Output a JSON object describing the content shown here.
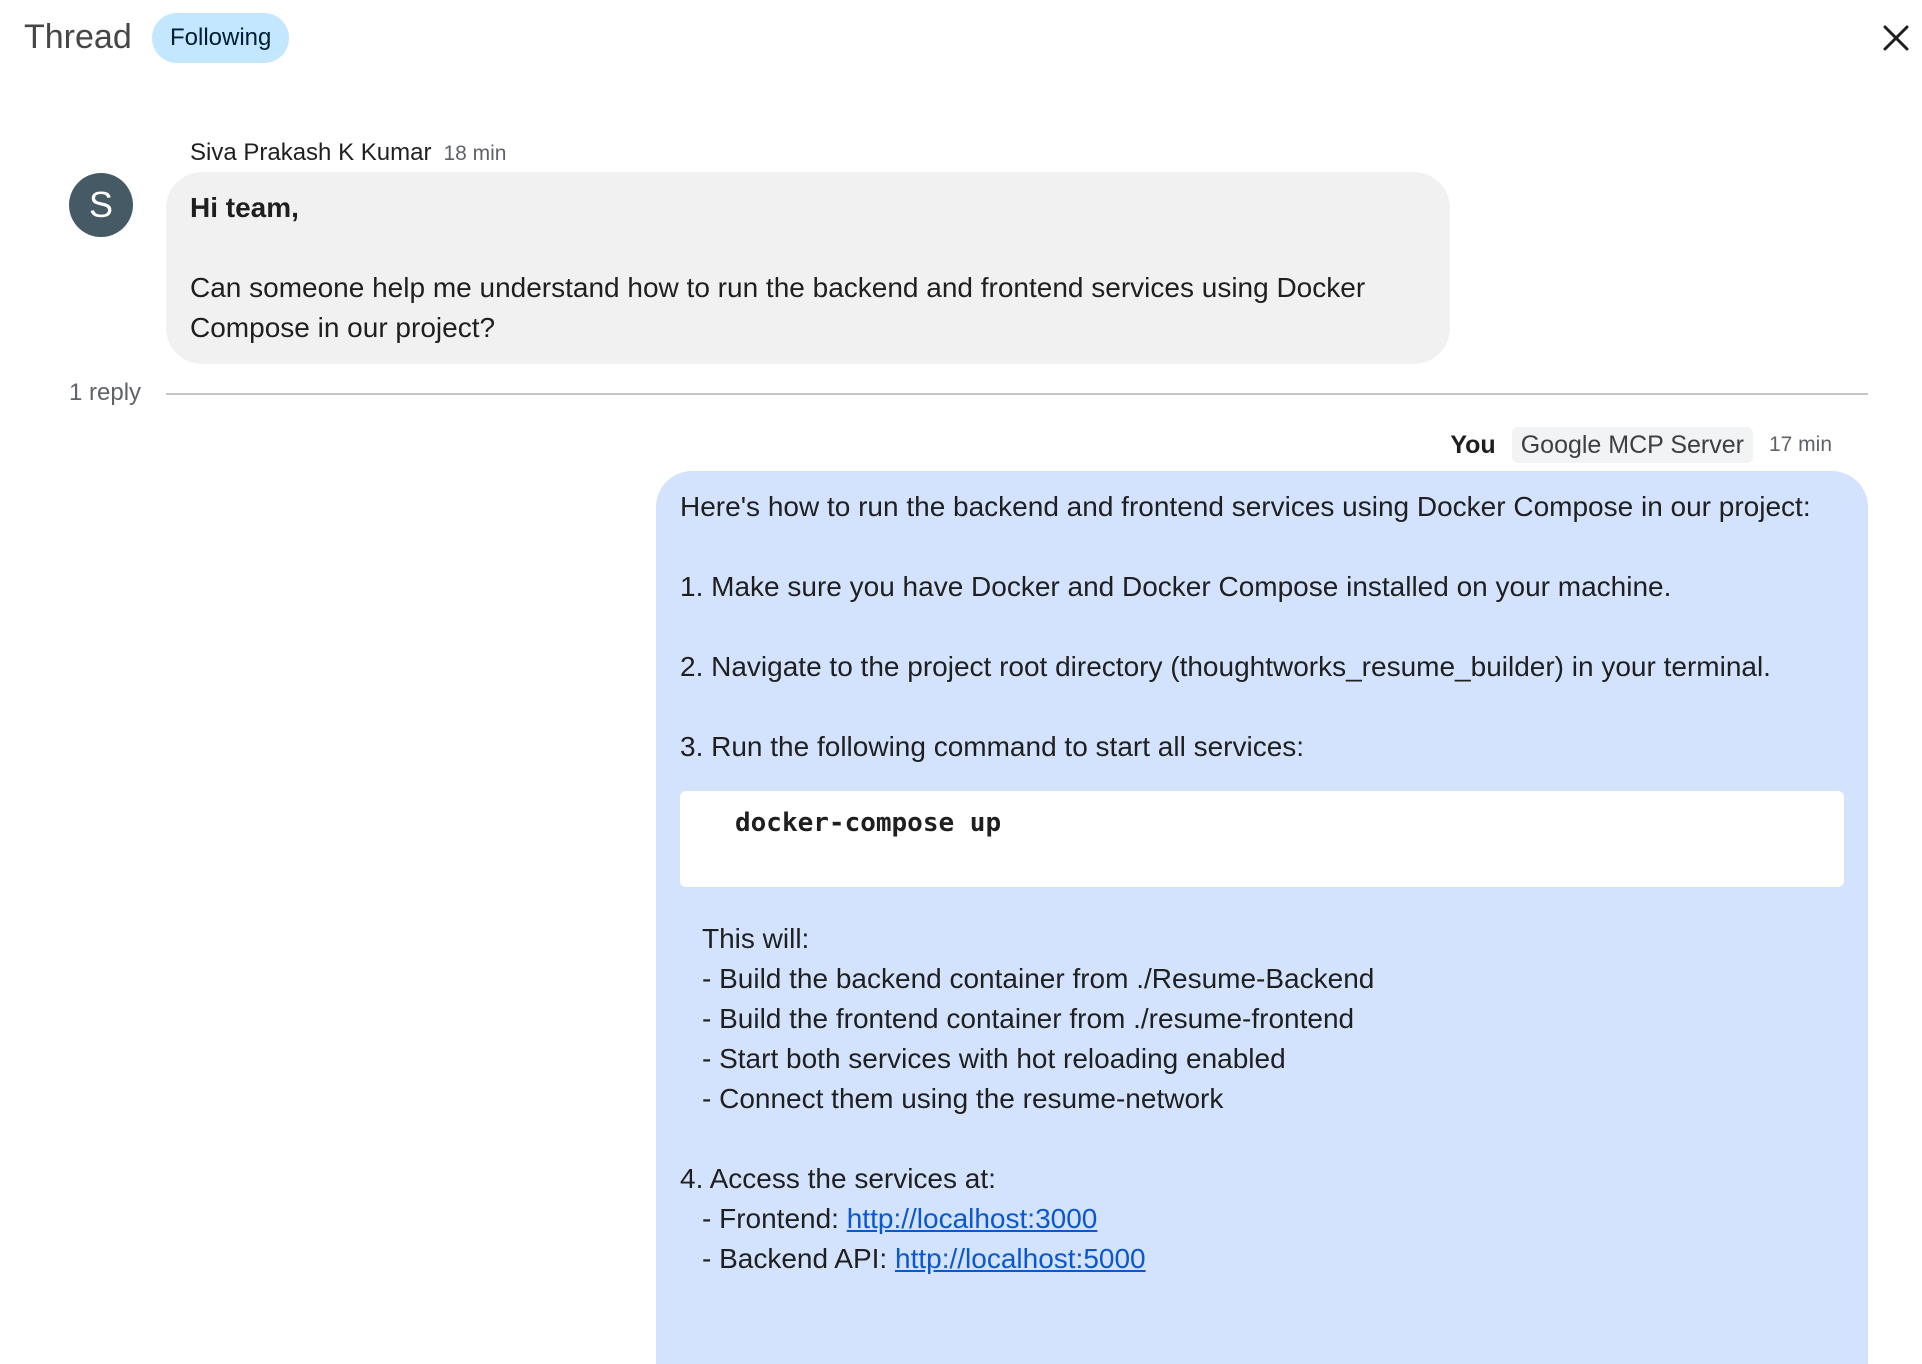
{
  "header": {
    "title": "Thread",
    "following_label": "Following"
  },
  "original_message": {
    "sender": "Siva Prakash K Kumar",
    "time": "18 min",
    "avatar_initial": "S",
    "greeting": "Hi team,",
    "body_line1": "Can someone help me understand how to run the backend and frontend services using Docker",
    "body_line2": "Compose in our project?"
  },
  "reply_count": "1 reply",
  "reply": {
    "author": "You",
    "app": "Google MCP Server",
    "time": "17 min",
    "intro": "Here's how to run the backend and frontend services using Docker Compose in our project:",
    "step1": "1. Make sure you have Docker and Docker Compose installed on your machine.",
    "step2": "2. Navigate to the project root directory (thoughtworks_resume_builder) in your terminal.",
    "step3": "3. Run the following command to start all services:",
    "code": "docker-compose up",
    "this_will": "This will:",
    "bullets": [
      "- Build the backend container from ./Resume-Backend",
      "- Build the frontend container from ./resume-frontend",
      "- Start both services with hot reloading enabled",
      "- Connect them using the resume-network"
    ],
    "step4": "4. Access the services at:",
    "frontend_label": "- Frontend: ",
    "frontend_url": "http://localhost:3000",
    "backend_label": "- Backend API: ",
    "backend_url": "http://localhost:5000"
  },
  "icons": {
    "close": "close-icon"
  },
  "colors": {
    "chip_bg": "#c2e7ff",
    "reply_bubble": "#d3e3fd",
    "message_bubble": "#f1f1f1",
    "avatar_bg": "#455a64",
    "link": "#0b57d0"
  }
}
